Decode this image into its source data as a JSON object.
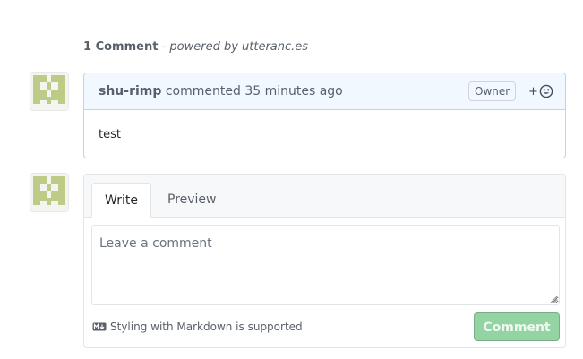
{
  "header": {
    "count_label": "1 Comment",
    "separator": " - ",
    "powered_prefix": "powered by ",
    "powered_link": "utteranc.es"
  },
  "comment": {
    "author": "shu-rimp",
    "action": "commented",
    "time_ago": "35 minutes ago",
    "badge": "Owner",
    "reaction_plus": "+",
    "body": "test"
  },
  "composer": {
    "tabs": [
      {
        "label": "Write",
        "active": true
      },
      {
        "label": "Preview",
        "active": false
      }
    ],
    "placeholder": "Leave a comment",
    "markdown_note": "Styling with Markdown is supported",
    "submit_label": "Comment"
  },
  "colors": {
    "avatar_green": "#bccc86",
    "button_green": "#94d3a2",
    "header_blue": "#f1f8ff",
    "border_blue": "#c0d3eb"
  },
  "icons": {
    "reaction": "smiley-icon",
    "markdown": "markdown-icon"
  }
}
